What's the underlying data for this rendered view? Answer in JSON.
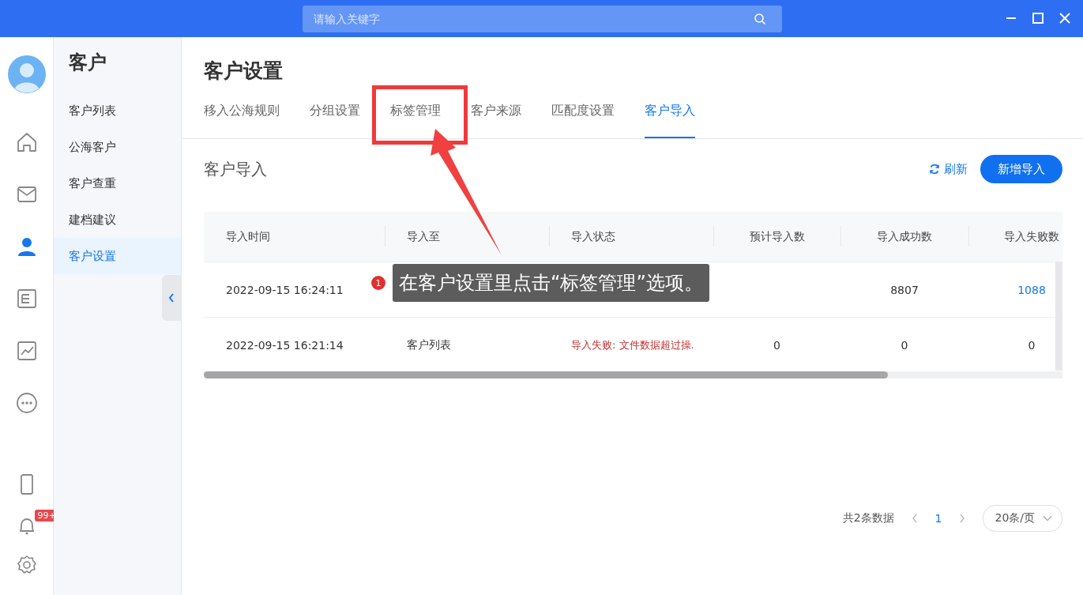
{
  "top_bar": {
    "search": {
      "placeholder": "请输入关键字"
    }
  },
  "rail": {
    "items": [
      {
        "selected": false
      },
      {
        "selected": false
      },
      {
        "selected": true
      },
      {
        "selected": false
      },
      {
        "selected": false
      },
      {
        "selected": false
      }
    ],
    "notification_badge": "99+"
  },
  "sidebar": {
    "title": "客户",
    "items": [
      {
        "label": "客户列表",
        "selected": false
      },
      {
        "label": "公海客户",
        "selected": false
      },
      {
        "label": "客户查重",
        "selected": false
      },
      {
        "label": "建档建议",
        "selected": false
      },
      {
        "label": "客户设置",
        "selected": true
      }
    ]
  },
  "page": {
    "title": "客户设置",
    "tabs": [
      {
        "label": "移入公海规则",
        "selected": false
      },
      {
        "label": "分组设置",
        "selected": false
      },
      {
        "label": "标签管理",
        "selected": false
      },
      {
        "label": "客户来源",
        "selected": false
      },
      {
        "label": "匹配度设置",
        "selected": false
      },
      {
        "label": "客户导入",
        "selected": true
      }
    ]
  },
  "section": {
    "title": "客户导入",
    "refresh": "刷新",
    "add_button": "新增导入"
  },
  "table": {
    "columns": [
      "导入时间",
      "导入至",
      "导入状态",
      "预计导入数",
      "导入成功数",
      "导入失败数"
    ],
    "rows": [
      {
        "time": {
          "text": "2022-09-15 16:24:11",
          "kind": "plain"
        },
        "success": {
          "text": "8807",
          "kind": "plain"
        },
        "failed": {
          "text": "1088",
          "kind": "link"
        }
      },
      {
        "time": {
          "text": "2022-09-15 16:21:14",
          "kind": "plain"
        },
        "target": {
          "text": "客户列表",
          "kind": "plain"
        },
        "status": {
          "text": "导入失败: 文件数据超过操.",
          "kind": "error"
        },
        "expected": {
          "text": "0",
          "kind": "plain"
        },
        "success": {
          "text": "0",
          "kind": "plain"
        },
        "failed": {
          "text": "0",
          "kind": "plain"
        }
      }
    ]
  },
  "pagination": {
    "total": "共2条数据",
    "current_page": "1",
    "page_size": "20条/页"
  },
  "annotation": {
    "number": "1",
    "text": "在客户设置里点击“标签管理”选项。"
  }
}
